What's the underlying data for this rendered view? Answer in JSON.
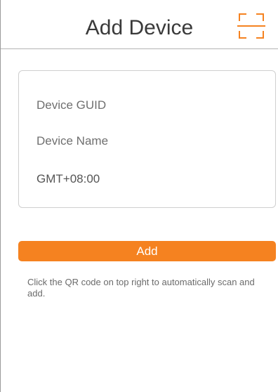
{
  "header": {
    "title": "Add Device",
    "scan_icon": "qr-scan-icon"
  },
  "form": {
    "guid_placeholder": "Device GUID",
    "name_placeholder": "Device Name",
    "timezone_value": "GMT+08:00"
  },
  "actions": {
    "add_label": "Add"
  },
  "hint_text": "Click the QR code on top right to automatically scan and add.",
  "colors": {
    "accent": "#f58220",
    "border": "#cfcfcf",
    "text": "#3a3a3a"
  }
}
